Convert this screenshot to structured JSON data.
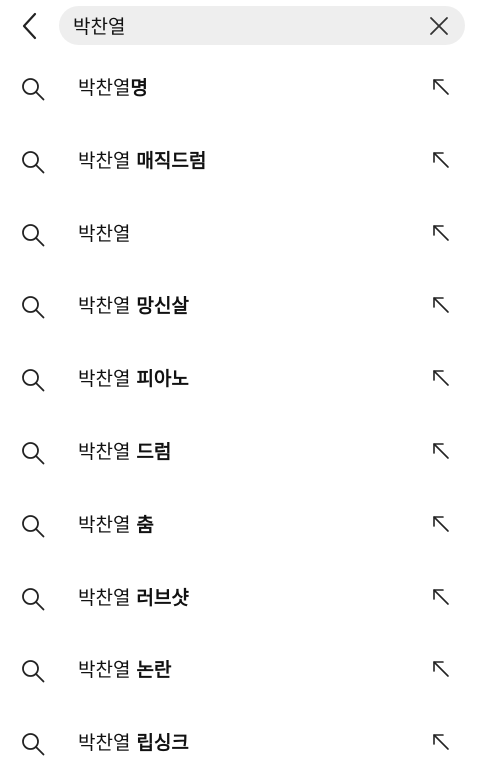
{
  "search": {
    "value": "박찬열"
  },
  "icons": {
    "back": "chevron-left-icon",
    "clear": "close-icon",
    "search": "search-icon",
    "fill": "arrow-up-left-icon"
  },
  "suggestions": [
    {
      "query": "박찬열",
      "sep": "",
      "rest": "명"
    },
    {
      "query": "박찬열",
      "sep": " ",
      "rest": "매직드럼"
    },
    {
      "query": "박찬열",
      "sep": "",
      "rest": ""
    },
    {
      "query": "박찬열",
      "sep": " ",
      "rest": "망신살"
    },
    {
      "query": "박찬열",
      "sep": " ",
      "rest": "피아노"
    },
    {
      "query": "박찬열",
      "sep": " ",
      "rest": "드럼"
    },
    {
      "query": "박찬열",
      "sep": " ",
      "rest": "춤"
    },
    {
      "query": "박찬열",
      "sep": " ",
      "rest": "러브샷"
    },
    {
      "query": "박찬열",
      "sep": " ",
      "rest": "논란"
    },
    {
      "query": "박찬열",
      "sep": " ",
      "rest": "립싱크"
    }
  ]
}
